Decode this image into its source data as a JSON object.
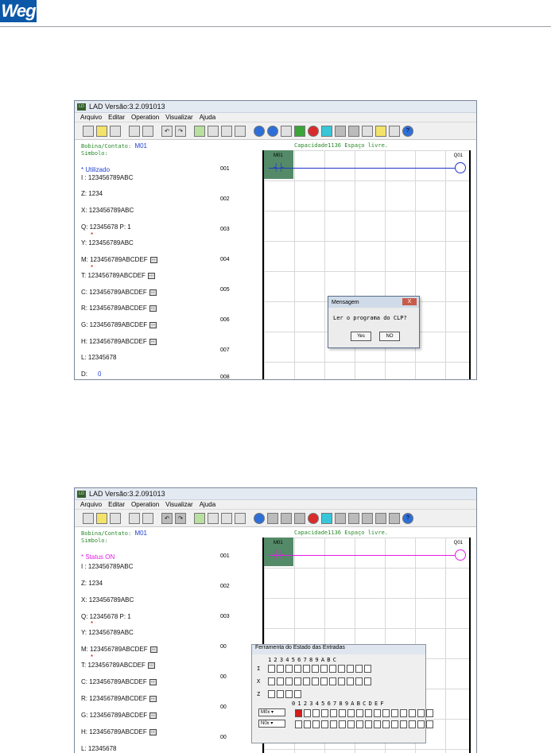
{
  "logo": {
    "text": "Weg"
  },
  "top": {
    "title": "LAD Versão:3.2.091013",
    "menu": [
      "Arquivo",
      "Editar",
      "Operation",
      "Visualizar",
      "Ajuda"
    ],
    "status": {
      "label": "Bobina/Contato:",
      "value": "M01",
      "capacity": "Capacidade1136 Espaço livre.",
      "symbol": "Simbolo:"
    },
    "mode": "* Utilizado",
    "registers": [
      "I : 123456789ABC",
      "Z: 1234",
      "X: 123456789ABC",
      "Q: 12345678   P: 1",
      "Y: 123456789ABC",
      "M: 123456789ABCDEF",
      "T: 123456789ABCDEF",
      "C: 123456789ABCDEF",
      "R: 123456789ABCDEF",
      "G: 123456789ABCDEF",
      "H: 123456789ABCDEF",
      "L: 12345678",
      "D:"
    ],
    "d_value": "0",
    "rows": [
      "001",
      "002",
      "003",
      "004",
      "005",
      "006",
      "007",
      "008"
    ],
    "contact_label": "M01",
    "coil_label": "Q01",
    "dialog": {
      "title": "Mensagem",
      "close": "X",
      "message": "Ler o programa do CLP?",
      "yes": "Yes",
      "no": "NO"
    }
  },
  "bottom": {
    "title": "LAD Versão:3.2.091013",
    "menu": [
      "Arquivo",
      "Editar",
      "Operation",
      "Visualizar",
      "Ajuda"
    ],
    "status": {
      "label": "Bobina/Contato:",
      "value": "M01",
      "capacity": "Capacidade1136 Espaço livre.",
      "symbol": "Simbolo:"
    },
    "mode": "* Status ON",
    "registers": [
      "I : 123456789ABC",
      "Z: 1234",
      "X: 123456789ABC",
      "Q: 12345678   P: 1",
      "Y: 123456789ABC",
      "M: 123456789ABCDEF",
      "T: 123456789ABCDEF",
      "C: 123456789ABCDEF",
      "R: 123456789ABCDEF",
      "G: 123456789ABCDEF",
      "H: 123456789ABCDEF",
      "L: 12345678"
    ],
    "rows": [
      "001",
      "002",
      "003",
      "00",
      "00",
      "00",
      "00"
    ],
    "contact_label": "M01",
    "coil_label": "Q01",
    "tool": {
      "title": "Ferramenta do Estado das Entradas",
      "i_header": "1 2 3 4 5 6 7 8 9 A B C",
      "i": "I",
      "x": "X",
      "z": "Z",
      "g_header": "0 1 2 3 4 5 6 7 8 9 A B C D E F",
      "sel1": "M0x",
      "sel2": "N0x"
    }
  },
  "colors": {
    "rung_top": "#1f35c8",
    "rung_bottom": "#e21be6",
    "accent": "#548a68"
  }
}
